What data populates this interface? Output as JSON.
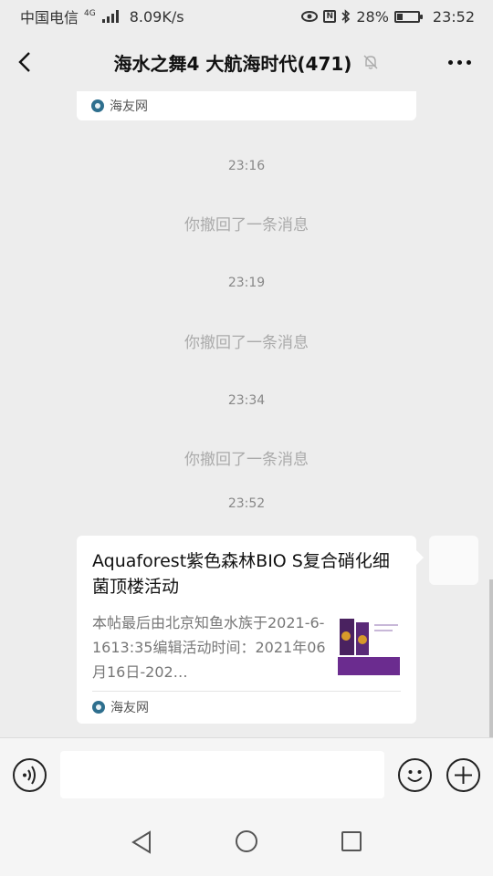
{
  "status_bar": {
    "carrier": "中国电信",
    "network": "4G",
    "speed": "8.09K/s",
    "battery": "28%",
    "battery_level": 0.28,
    "nfc": "N",
    "time": "23:52"
  },
  "header": {
    "title": "海水之舞4 大航海时代(471)"
  },
  "chat": {
    "top_card_source": "海友网",
    "events": [
      {
        "time": "23:16",
        "recall": "你撤回了一条消息"
      },
      {
        "time": "23:19",
        "recall": "你撤回了一条消息"
      },
      {
        "time": "23:34",
        "recall": "你撤回了一条消息"
      }
    ],
    "last_time": "23:52",
    "message": {
      "title": "Aquaforest紫色森林BIO S复合硝化细菌顶楼活动",
      "description": "本帖最后由北京知鱼水族于2021-6-1613:35编辑活动时间：2021年06月16日-202…",
      "source": "海友网"
    }
  },
  "input": {
    "placeholder": ""
  },
  "icons": {
    "back": "back-arrow-icon",
    "mute": "bell-off-icon",
    "more": "more-dots-icon",
    "voice": "voice-icon",
    "emoji": "emoji-icon",
    "plus": "plus-icon",
    "site": "site-logo-icon"
  }
}
